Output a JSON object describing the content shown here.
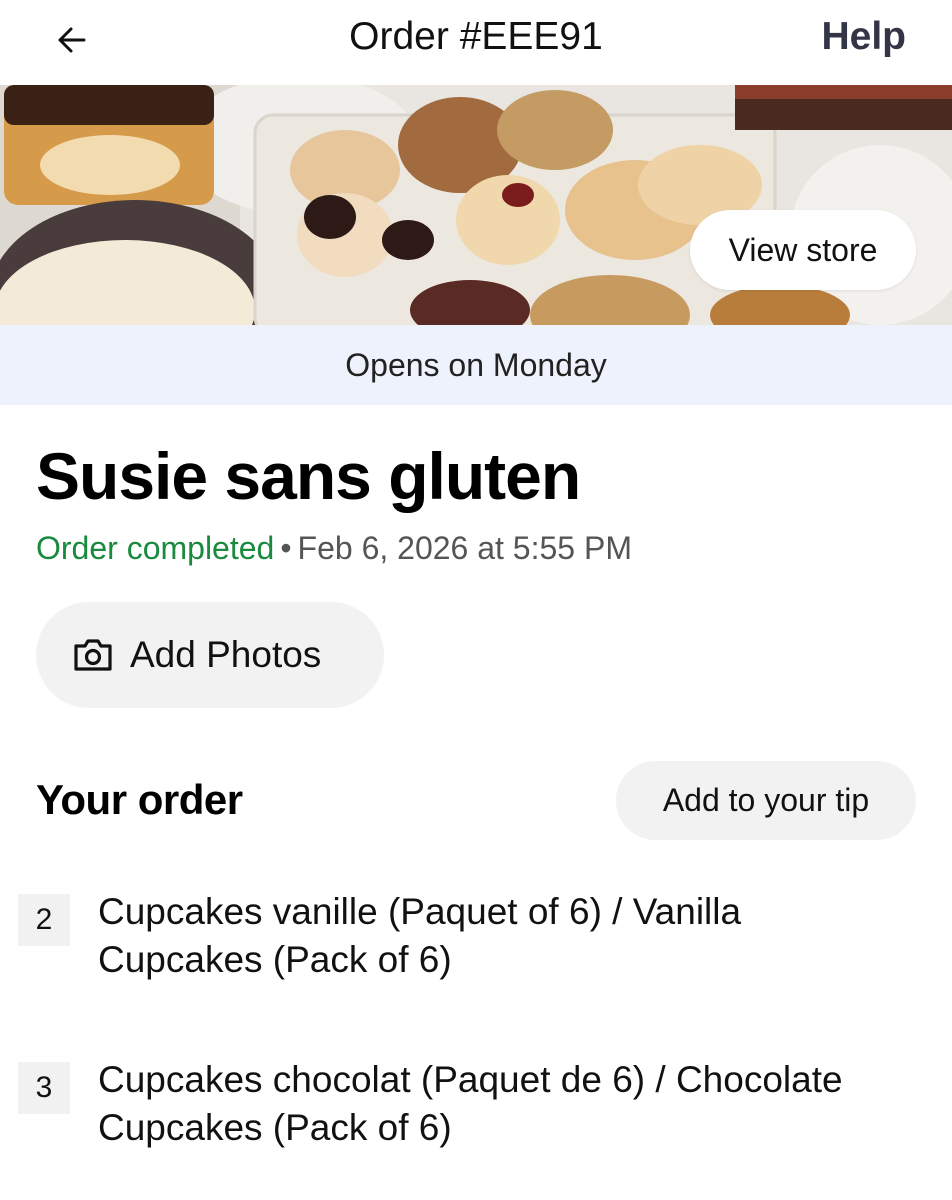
{
  "header": {
    "title": "Order #EEE91",
    "help_label": "Help",
    "back_icon": "arrow-left-icon"
  },
  "banner": {
    "view_store_label": "View store"
  },
  "store_hours_notice": "Opens on Monday",
  "store": {
    "name": "Susie sans gluten",
    "status": "Order completed",
    "separator": "•",
    "date": "Feb 6, 2026 at 5:55 PM",
    "status_color": "#1a8a3e"
  },
  "add_photos": {
    "icon": "camera-icon",
    "label": "Add Photos"
  },
  "order": {
    "heading": "Your order",
    "tip_label": "Add to your tip",
    "items": [
      {
        "qty": "2",
        "name": "Cupcakes vanille (Paquet of 6) / Vanilla Cupcakes (Pack of 6)"
      },
      {
        "qty": "3",
        "name": "Cupcakes chocolat (Paquet de 6) / Chocolate Cupcakes (Pack of 6)"
      }
    ]
  }
}
